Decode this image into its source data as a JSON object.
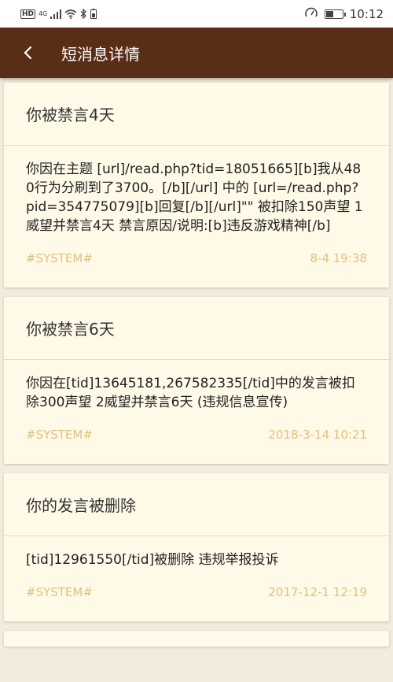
{
  "status_bar": {
    "hd": "HD",
    "network": "4G",
    "time": "10:12"
  },
  "header": {
    "title": "短消息详情"
  },
  "messages": [
    {
      "title": "你被禁言4天",
      "content": "你因在主题 [url]/read.php?tid=18051665][b]我从480行为分刷到了3700。[/b][/url] 中的 [url=/read.php?pid=354775079][b]回复[/b][/url]\"\" 被扣除150声望 1威望并禁言4天 禁言原因/说明:[b]违反游戏精神[/b]",
      "sender": "#SYSTEM#",
      "time": "8-4 19:38"
    },
    {
      "title": "你被禁言6天",
      "content": "你因在[tid]13645181,267582335[/tid]中的发言被扣除300声望 2威望并禁言6天 (违规信息宣传)",
      "sender": "#SYSTEM#",
      "time": "2018-3-14 10:21"
    },
    {
      "title": "你的发言被删除",
      "content": "[tid]12961550[/tid]被删除 违规举报投诉",
      "sender": "#SYSTEM#",
      "time": "2017-12-1 12:19"
    }
  ],
  "colors": {
    "app_bar": "#5a2d17",
    "card_bg": "#fff9e8",
    "meta_text": "#e0c27a"
  }
}
